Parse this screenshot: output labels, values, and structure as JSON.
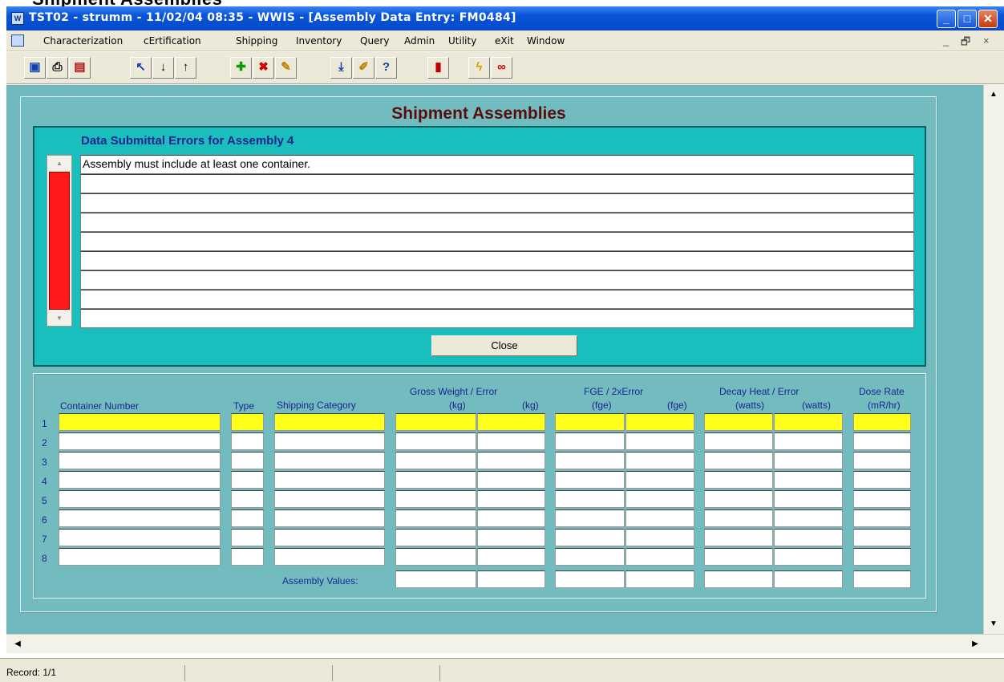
{
  "window": {
    "title": "TST02 - strumm - 11/02/04 08:35 - WWIS - [Assembly Data Entry: FM0484]",
    "buttons": [
      "_",
      "□",
      "✕"
    ]
  },
  "top_heading": "Shipment Assemblies",
  "menu": {
    "items": [
      "Characterization",
      "cErtification",
      "Shipping",
      "Inventory",
      "Query",
      "Admin",
      "Utility",
      "eXit",
      "Window"
    ],
    "mdi_controls": [
      "_",
      "🗗",
      "×"
    ]
  },
  "toolbar": {
    "groups": [
      [
        "save-icon",
        "print-icon",
        "print-preview-icon"
      ],
      [
        "enter-query-icon",
        "next-record-icon",
        "previous-record-icon"
      ],
      [
        "insert-record-icon",
        "delete-record-icon",
        "clear-icon"
      ],
      [
        "download-icon",
        "edit-icon",
        "help-icon"
      ],
      [
        "exit-door-icon"
      ],
      [
        "lightning-icon",
        "glasses-icon"
      ]
    ]
  },
  "form": {
    "title": "Shipment Assemblies",
    "errors": {
      "heading": "Data Submittal Errors for Assembly 4",
      "lines": [
        "Assembly must include at least one container.",
        "",
        "",
        "",
        "",
        "",
        "",
        "",
        ""
      ],
      "close_label": "Close"
    },
    "grid": {
      "headers": {
        "container_number": "Container Number",
        "type": "Type",
        "shipping_category": "Shipping Category",
        "gross_weight": "Gross Weight / Error",
        "gross_weight_unit_1": "(kg)",
        "gross_weight_unit_2": "(kg)",
        "fge": "FGE / 2xError",
        "fge_unit_1": "(fge)",
        "fge_unit_2": "(fge)",
        "decay_heat": "Decay Heat / Error",
        "decay_heat_unit_1": "(watts)",
        "decay_heat_unit_2": "(watts)",
        "dose_rate": "Dose Rate",
        "dose_rate_unit": "(mR/hr)"
      },
      "row_numbers": [
        "1",
        "2",
        "3",
        "4",
        "5",
        "6",
        "7",
        "8"
      ],
      "assembly_values_label": "Assembly Values:"
    }
  },
  "status": {
    "record": "Record: 1/1"
  },
  "colors": {
    "titlebar": "#0549c9",
    "form_bg": "#72bcc0",
    "error_panel": "#1abfbd",
    "heading_text": "#1b248f",
    "form_title": "#5b0d0d",
    "current_row": "#ffff1a",
    "scroll_thumb": "#ff1a1a"
  }
}
